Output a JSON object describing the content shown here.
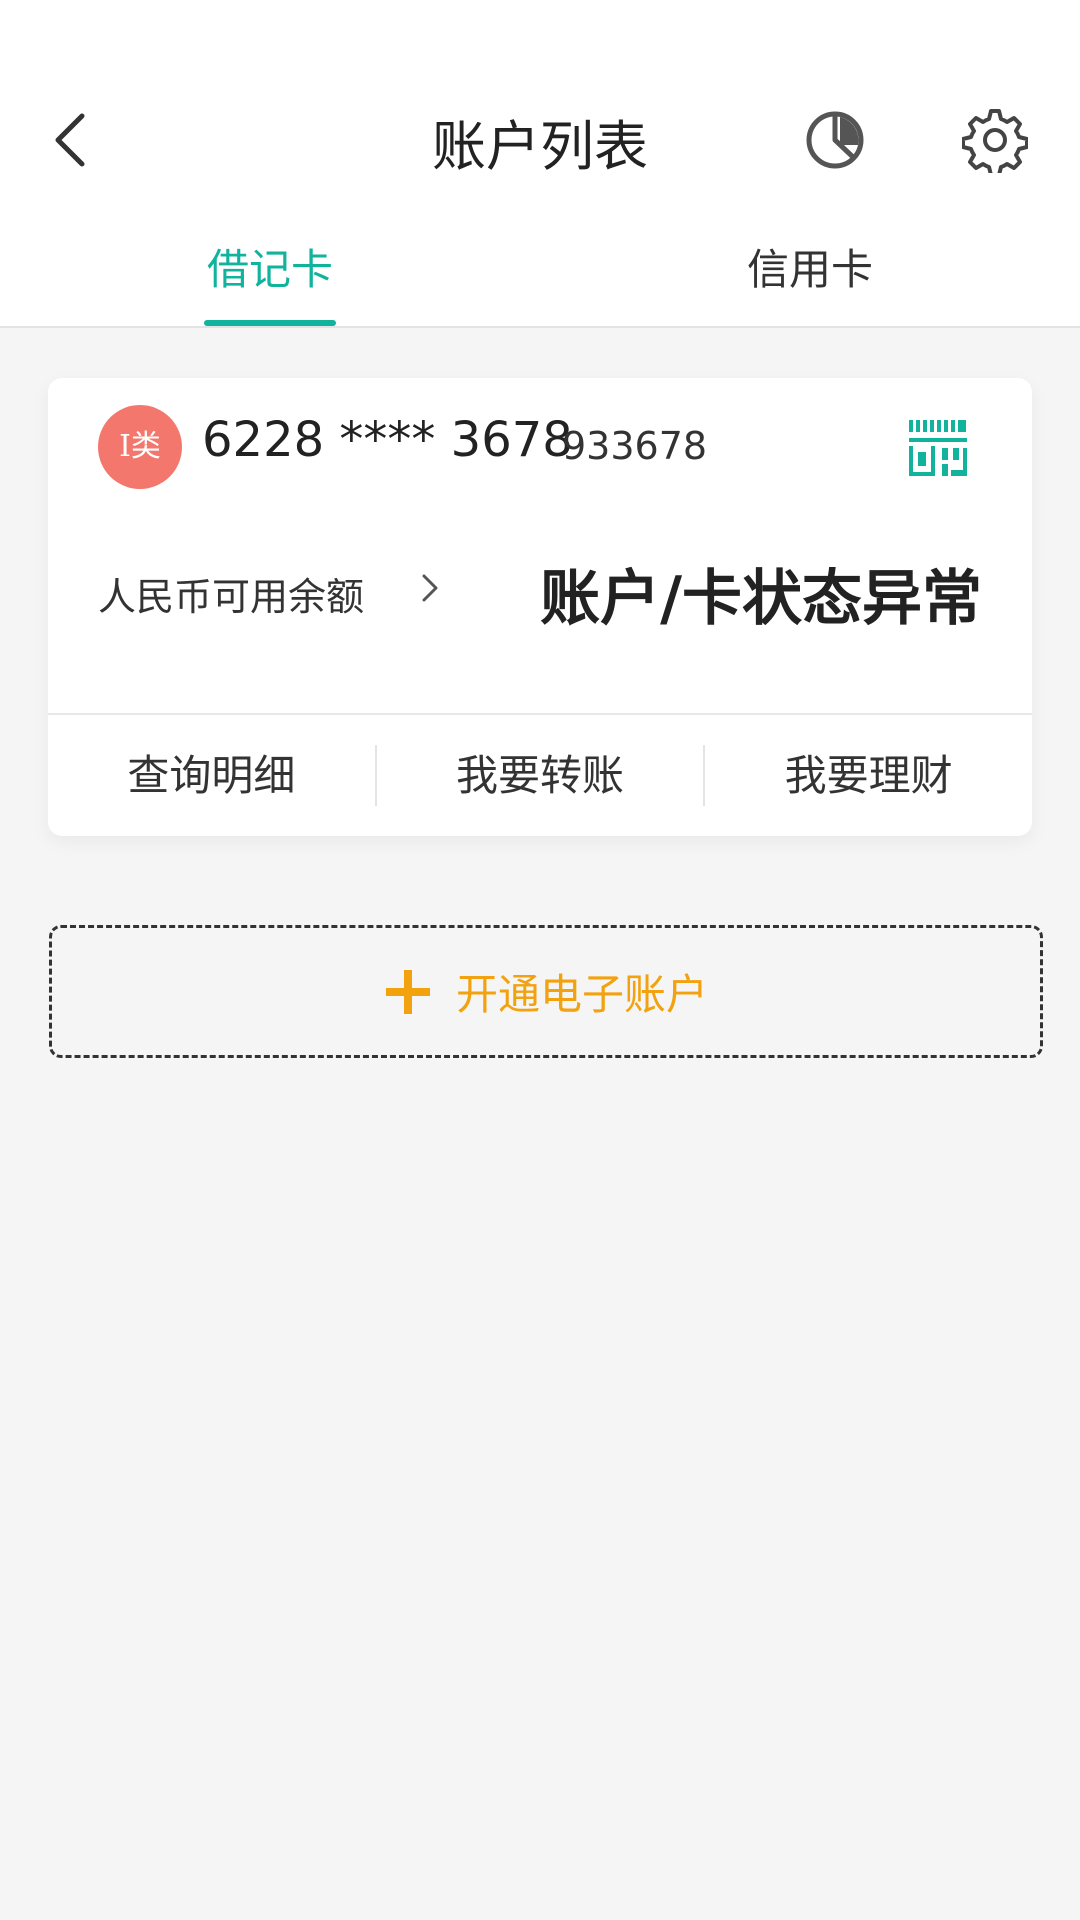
{
  "header": {
    "title": "账户列表",
    "back_icon": "chevron-left-icon",
    "stats_icon": "pie-chart-icon",
    "settings_icon": "gear-icon"
  },
  "tabs": [
    {
      "label": "借记卡",
      "active": true
    },
    {
      "label": "信用卡",
      "active": false
    }
  ],
  "card": {
    "badge": "I类",
    "number": "6228 **** 3678",
    "suffix": "933678",
    "qr_icon": "qr-code-icon",
    "balance_label": "人民币可用余额",
    "status": "账户/卡状态异常",
    "actions": [
      "查询明细",
      "我要转账",
      "我要理财"
    ]
  },
  "open_account": {
    "label": "开通电子账户"
  },
  "colors": {
    "accent": "#11b39c",
    "badge": "#f4776d",
    "orange": "#f2a20f",
    "background": "#f5f5f5"
  }
}
